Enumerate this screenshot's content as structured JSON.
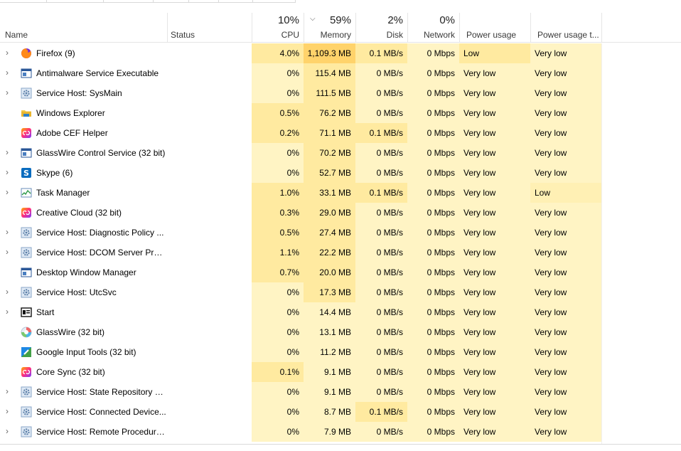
{
  "header": {
    "name_label": "Name",
    "status_label": "Status",
    "cpu_pct": "10%",
    "cpu_label": "CPU",
    "memory_pct": "59%",
    "memory_label": "Memory",
    "disk_pct": "2%",
    "disk_label": "Disk",
    "network_pct": "0%",
    "network_label": "Network",
    "power_label": "Power usage",
    "power_trend_label": "Power usage t..."
  },
  "colors": {
    "heat_light": "#fff4c4",
    "heat_mid": "#ffeaa0",
    "heat_strong": "#ffd36b"
  },
  "processes": [
    {
      "name": "Firefox (9)",
      "icon": "firefox-icon",
      "expandable": true,
      "cpu": "4.0%",
      "memory": "1,109.3 MB",
      "disk": "0.1 MB/s",
      "network": "0 Mbps",
      "power": "Low",
      "power_trend": "Very low"
    },
    {
      "name": "Antimalware Service Executable",
      "icon": "service-window-icon",
      "expandable": true,
      "cpu": "0%",
      "memory": "115.4 MB",
      "disk": "0 MB/s",
      "network": "0 Mbps",
      "power": "Very low",
      "power_trend": "Very low"
    },
    {
      "name": "Service Host: SysMain",
      "icon": "gear-icon",
      "expandable": true,
      "cpu": "0%",
      "memory": "111.5 MB",
      "disk": "0 MB/s",
      "network": "0 Mbps",
      "power": "Very low",
      "power_trend": "Very low"
    },
    {
      "name": "Windows Explorer",
      "icon": "folder-icon",
      "expandable": false,
      "cpu": "0.5%",
      "memory": "76.2 MB",
      "disk": "0 MB/s",
      "network": "0 Mbps",
      "power": "Very low",
      "power_trend": "Very low"
    },
    {
      "name": "Adobe CEF Helper",
      "icon": "creative-cloud-icon",
      "expandable": false,
      "cpu": "0.2%",
      "memory": "71.1 MB",
      "disk": "0.1 MB/s",
      "network": "0 Mbps",
      "power": "Very low",
      "power_trend": "Very low"
    },
    {
      "name": "GlassWire Control Service (32 bit)",
      "icon": "service-window-icon",
      "expandable": true,
      "cpu": "0%",
      "memory": "70.2 MB",
      "disk": "0 MB/s",
      "network": "0 Mbps",
      "power": "Very low",
      "power_trend": "Very low"
    },
    {
      "name": "Skype (6)",
      "icon": "skype-icon",
      "expandable": true,
      "cpu": "0%",
      "memory": "52.7 MB",
      "disk": "0 MB/s",
      "network": "0 Mbps",
      "power": "Very low",
      "power_trend": "Very low"
    },
    {
      "name": "Task Manager",
      "icon": "task-manager-icon",
      "expandable": true,
      "cpu": "1.0%",
      "memory": "33.1 MB",
      "disk": "0.1 MB/s",
      "network": "0 Mbps",
      "power": "Very low",
      "power_trend": "Low"
    },
    {
      "name": "Creative Cloud (32 bit)",
      "icon": "creative-cloud-icon",
      "expandable": false,
      "cpu": "0.3%",
      "memory": "29.0 MB",
      "disk": "0 MB/s",
      "network": "0 Mbps",
      "power": "Very low",
      "power_trend": "Very low"
    },
    {
      "name": "Service Host: Diagnostic Policy ...",
      "icon": "gear-icon",
      "expandable": true,
      "cpu": "0.5%",
      "memory": "27.4 MB",
      "disk": "0 MB/s",
      "network": "0 Mbps",
      "power": "Very low",
      "power_trend": "Very low"
    },
    {
      "name": "Service Host: DCOM Server Proc...",
      "icon": "gear-icon",
      "expandable": true,
      "cpu": "1.1%",
      "memory": "22.2 MB",
      "disk": "0 MB/s",
      "network": "0 Mbps",
      "power": "Very low",
      "power_trend": "Very low"
    },
    {
      "name": "Desktop Window Manager",
      "icon": "service-window-icon",
      "expandable": false,
      "cpu": "0.7%",
      "memory": "20.0 MB",
      "disk": "0 MB/s",
      "network": "0 Mbps",
      "power": "Very low",
      "power_trend": "Very low"
    },
    {
      "name": "Service Host: UtcSvc",
      "icon": "gear-icon",
      "expandable": true,
      "cpu": "0%",
      "memory": "17.3 MB",
      "disk": "0 MB/s",
      "network": "0 Mbps",
      "power": "Very low",
      "power_trend": "Very low"
    },
    {
      "name": "Start",
      "icon": "start-icon",
      "expandable": true,
      "cpu": "0%",
      "memory": "14.4 MB",
      "disk": "0 MB/s",
      "network": "0 Mbps",
      "power": "Very low",
      "power_trend": "Very low"
    },
    {
      "name": "GlassWire (32 bit)",
      "icon": "glasswire-icon",
      "expandable": false,
      "cpu": "0%",
      "memory": "13.1 MB",
      "disk": "0 MB/s",
      "network": "0 Mbps",
      "power": "Very low",
      "power_trend": "Very low"
    },
    {
      "name": "Google Input Tools (32 bit)",
      "icon": "google-input-icon",
      "expandable": false,
      "cpu": "0%",
      "memory": "11.2 MB",
      "disk": "0 MB/s",
      "network": "0 Mbps",
      "power": "Very low",
      "power_trend": "Very low"
    },
    {
      "name": "Core Sync (32 bit)",
      "icon": "creative-cloud-icon",
      "expandable": false,
      "cpu": "0.1%",
      "memory": "9.1 MB",
      "disk": "0 MB/s",
      "network": "0 Mbps",
      "power": "Very low",
      "power_trend": "Very low"
    },
    {
      "name": "Service Host: State Repository S...",
      "icon": "gear-icon",
      "expandable": true,
      "cpu": "0%",
      "memory": "9.1 MB",
      "disk": "0 MB/s",
      "network": "0 Mbps",
      "power": "Very low",
      "power_trend": "Very low"
    },
    {
      "name": "Service Host: Connected Device...",
      "icon": "gear-icon",
      "expandable": true,
      "cpu": "0%",
      "memory": "8.7 MB",
      "disk": "0.1 MB/s",
      "network": "0 Mbps",
      "power": "Very low",
      "power_trend": "Very low"
    },
    {
      "name": "Service Host: Remote Procedure...",
      "icon": "gear-icon",
      "expandable": true,
      "cpu": "0%",
      "memory": "7.9 MB",
      "disk": "0 MB/s",
      "network": "0 Mbps",
      "power": "Very low",
      "power_trend": "Very low"
    }
  ]
}
